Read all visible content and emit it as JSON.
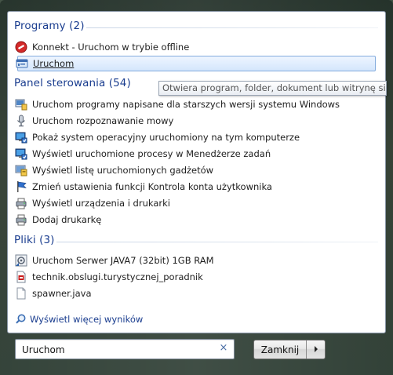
{
  "sections": [
    {
      "header": "Programy (2)",
      "items": [
        {
          "label": "Konnekt - Uruchom w trybie offline",
          "icon": "konnekt-offline-icon"
        },
        {
          "label": "Uruchom",
          "icon": "run-dialog-icon",
          "selected": true
        }
      ]
    },
    {
      "header": "Panel sterowania (54)",
      "items": [
        {
          "label": "Uruchom programy napisane dla starszych wersji systemu Windows",
          "icon": "compatibility-icon"
        },
        {
          "label": "Uruchom rozpoznawanie mowy",
          "icon": "microphone-icon"
        },
        {
          "label": "Pokaż system operacyjny uruchomiony na tym komputerze",
          "icon": "system-icon"
        },
        {
          "label": "Wyświetl uruchomione procesy w Menedżerze zadań",
          "icon": "task-manager-icon"
        },
        {
          "label": "Wyświetl listę uruchomionych gadżetów",
          "icon": "gadgets-icon"
        },
        {
          "label": "Zmień ustawienia funkcji Kontrola konta użytkownika",
          "icon": "uac-flag-icon"
        },
        {
          "label": "Wyświetl urządzenia i drukarki",
          "icon": "devices-printers-icon"
        },
        {
          "label": "Dodaj drukarkę",
          "icon": "add-printer-icon"
        }
      ]
    },
    {
      "header": "Pliki (3)",
      "items": [
        {
          "label": "Uruchom Serwer JAVA7 (32bit) 1GB RAM",
          "icon": "shortcut-settings-icon"
        },
        {
          "label": "technik.obslugi.turystycznej_poradnik",
          "icon": "pdf-document-icon"
        },
        {
          "label": "spawner.java",
          "icon": "blank-file-icon"
        }
      ]
    }
  ],
  "tooltip": "Otwiera program, folder, dokument lub witrynę sieci web.",
  "more_results": "Wyświetl więcej wyników",
  "search": {
    "value": "Uruchom",
    "clear": "×"
  },
  "shutdown_button": {
    "label": "Zamknij"
  },
  "colors": {
    "header": "#1a3d8f",
    "selected_bg": "#d4e6fc",
    "selected_border": "#84acdd"
  }
}
